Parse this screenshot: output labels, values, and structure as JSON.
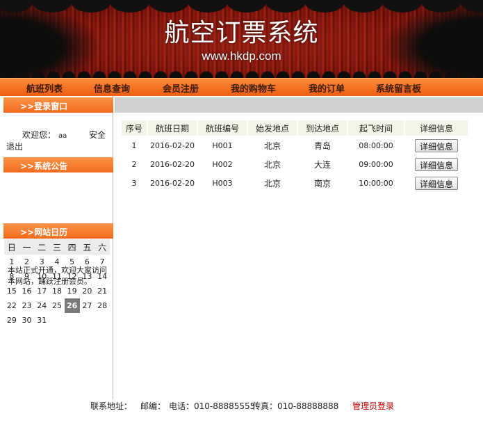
{
  "banner": {
    "title": "航空订票系统",
    "url": "www.hkdp.com"
  },
  "nav": [
    "航班列表",
    "信息查询",
    "会员注册",
    "我的购物车",
    "我的订单",
    "系统留言板"
  ],
  "sidebar": {
    "login": {
      "heading": ">>登录窗口",
      "welcome": "欢迎您：",
      "user": "aa",
      "safe_logout": "安全",
      "logout": "退出"
    },
    "announcement": {
      "heading": ">>系统公告",
      "text": "本站正式开通，欢迎大家访问本网站，踊跃注册会员。"
    },
    "calendar": {
      "heading": ">>网站日历",
      "weekdays": [
        "日",
        "一",
        "二",
        "三",
        "四",
        "五",
        "六"
      ],
      "weeks": [
        [
          "1",
          "2",
          "3",
          "4",
          "5",
          "6",
          "7"
        ],
        [
          "8",
          "9",
          "10",
          "11",
          "12",
          "13",
          "14"
        ],
        [
          "15",
          "16",
          "17",
          "18",
          "19",
          "20",
          "21"
        ],
        [
          "22",
          "23",
          "24",
          "25",
          "26",
          "27",
          "28"
        ],
        [
          "29",
          "30",
          "31",
          "",
          "",
          "",
          ""
        ]
      ],
      "today": "26"
    }
  },
  "flights": {
    "columns": [
      "序号",
      "航班日期",
      "航班编号",
      "始发地点",
      "到达地点",
      "起飞时间",
      "详细信息"
    ],
    "rows": [
      {
        "no": "1",
        "date": "2016-02-20",
        "code": "H001",
        "from": "北京",
        "to": "青岛",
        "time": "08:00:00",
        "action": "详细信息"
      },
      {
        "no": "2",
        "date": "2016-02-20",
        "code": "H002",
        "from": "北京",
        "to": "大连",
        "time": "09:00:00",
        "action": "详细信息"
      },
      {
        "no": "3",
        "date": "2016-02-20",
        "code": "H003",
        "from": "北京",
        "to": "南京",
        "time": "10:00:00",
        "action": "详细信息"
      }
    ]
  },
  "footer": {
    "address": "联系地址：",
    "zip": "邮编：",
    "phone": "电话：010-88885555",
    "fax": "传真：010-88888888",
    "admin": "管理员登录"
  },
  "colors": {
    "nav_orange": "#f07020",
    "admin_red": "#c00000",
    "today_gray": "#7a7a7a"
  }
}
